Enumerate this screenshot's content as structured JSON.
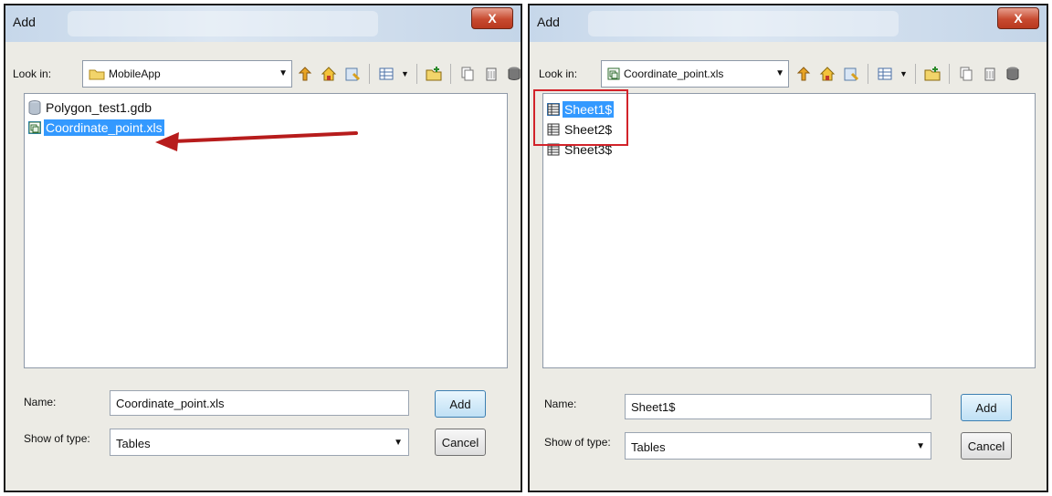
{
  "left": {
    "title": "Add",
    "close_glyph": "X",
    "look_in_label": "Look in:",
    "look_in_value": "MobileApp",
    "items": [
      {
        "label": "Polygon_test1.gdb",
        "icon": "database-icon"
      },
      {
        "label": "Coordinate_point.xls",
        "icon": "excel-file-icon"
      }
    ],
    "name_label": "Name:",
    "name_value": "Coordinate_point.xls",
    "type_label": "Show of type:",
    "type_value": "Tables",
    "add_label": "Add",
    "cancel_label": "Cancel"
  },
  "right": {
    "title": "Add",
    "close_glyph": "X",
    "look_in_label": "Look in:",
    "look_in_value": "Coordinate_point.xls",
    "items": [
      {
        "label": "Sheet1$",
        "icon": "table-icon"
      },
      {
        "label": "Sheet2$",
        "icon": "table-icon"
      },
      {
        "label": "Sheet3$",
        "icon": "table-icon"
      }
    ],
    "name_label": "Name:",
    "name_value": "Sheet1$",
    "type_label": "Show of type:",
    "type_value": "Tables",
    "add_label": "Add",
    "cancel_label": "Cancel"
  },
  "colors": {
    "selection": "#3399ff",
    "annotation_red": "#d2232a",
    "arrow_red": "#b71c1c"
  }
}
